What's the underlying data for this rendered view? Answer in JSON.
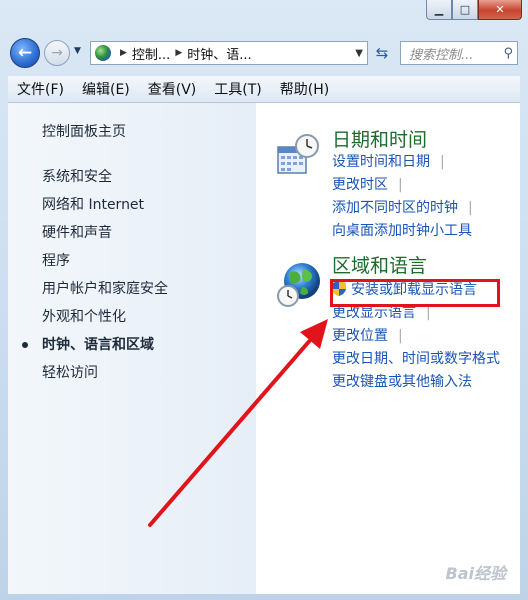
{
  "window": {
    "minimize_glyph": "▁",
    "maximize_glyph": "□",
    "close_glyph": "✕"
  },
  "nav": {
    "back_glyph": "←",
    "forward_glyph": "→",
    "address": [
      "控制...",
      "时钟、语..."
    ],
    "search_placeholder": "搜索控制..."
  },
  "menu": [
    "文件(F)",
    "编辑(E)",
    "查看(V)",
    "工具(T)",
    "帮助(H)"
  ],
  "sidebar": {
    "home": "控制面板主页",
    "items": [
      {
        "label": "系统和安全"
      },
      {
        "label": "网络和 Internet"
      },
      {
        "label": "硬件和声音"
      },
      {
        "label": "程序"
      },
      {
        "label": "用户帐户和家庭安全"
      },
      {
        "label": "外观和个性化"
      },
      {
        "label": "时钟、语言和区域",
        "active": true
      },
      {
        "label": "轻松访问"
      }
    ]
  },
  "categories": [
    {
      "title": "日期和时间",
      "icon": "calendar-clock-icon",
      "links": [
        "设置时间和日期",
        "更改时区",
        "添加不同时区的时钟",
        "向桌面添加时钟小工具"
      ]
    },
    {
      "title": "区域和语言",
      "icon": "globe-clock-icon",
      "links": [
        "安装或卸载显示语言",
        "更改显示语言",
        "更改位置",
        "更改日期、时间或数字格式",
        "更改键盘或其他输入法"
      ]
    }
  ],
  "colors": {
    "category_title": "#1e6b2c",
    "link": "#1a55b5",
    "highlight": "#e0141a"
  },
  "watermark": "Bai经验"
}
